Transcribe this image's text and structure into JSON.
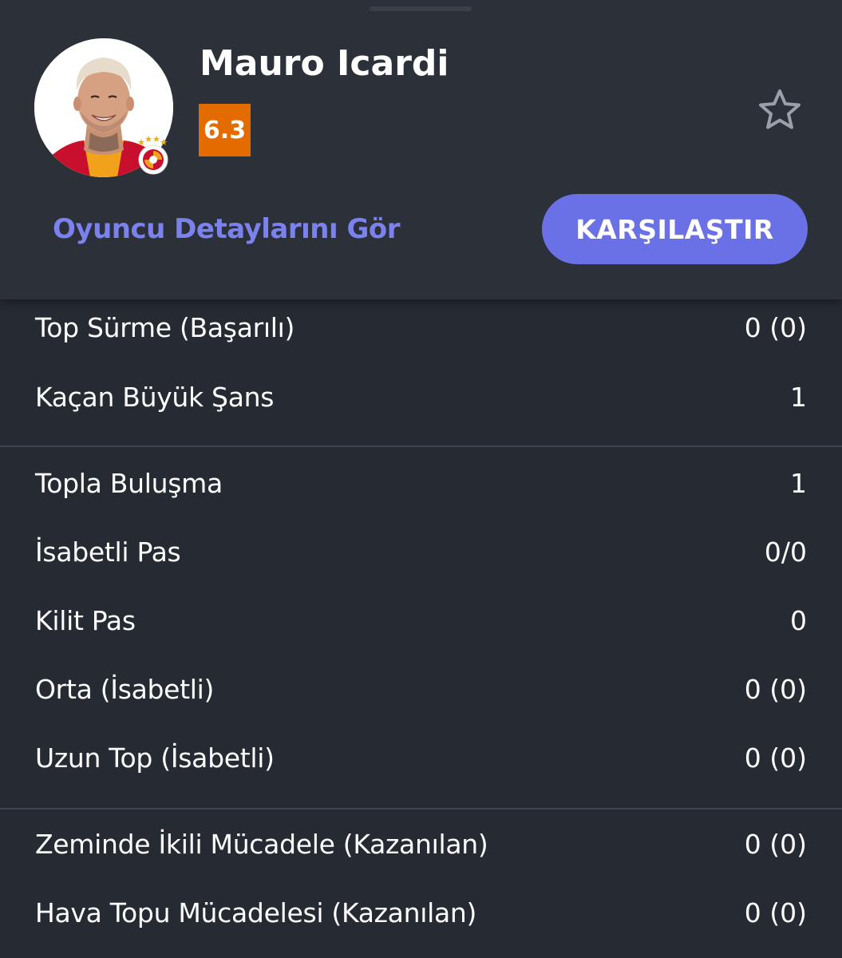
{
  "player": {
    "name": "Mauro Icardi",
    "rating": "6.3",
    "rating_color": "#e36b00"
  },
  "actions": {
    "details_link": "Oyuncu Detaylarını Gör",
    "compare_button": "KARŞILAŞTIR"
  },
  "icons": {
    "favorite": "star-outline-icon",
    "team": "galatasaray-badge-icon"
  },
  "colors": {
    "background": "#262a33",
    "header_background": "#2c3039",
    "accent": "#6a70e6",
    "link": "#7b82ee"
  },
  "stats": {
    "group1": [
      {
        "label": "Top Sürme (Başarılı)",
        "value": "0 (0)"
      },
      {
        "label": "Kaçan Büyük Şans",
        "value": "1"
      }
    ],
    "group2": [
      {
        "label": "Topla Buluşma",
        "value": "1"
      },
      {
        "label": "İsabetli Pas",
        "value": "0/0"
      },
      {
        "label": "Kilit Pas",
        "value": "0"
      },
      {
        "label": "Orta (İsabetli)",
        "value": "0 (0)"
      },
      {
        "label": "Uzun Top (İsabetli)",
        "value": "0 (0)"
      }
    ],
    "group3": [
      {
        "label": "Zeminde İkili Mücadele (Kazanılan)",
        "value": "0 (0)"
      },
      {
        "label": "Hava Topu Mücadelesi (Kazanılan)",
        "value": "0 (0)"
      }
    ]
  }
}
